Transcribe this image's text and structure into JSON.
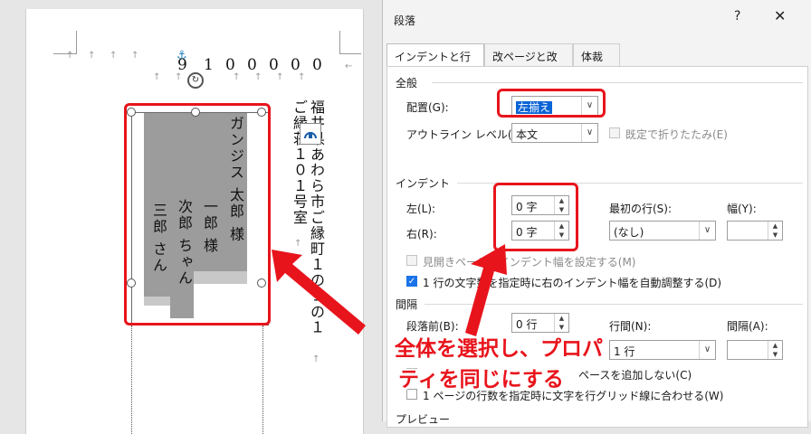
{
  "document": {
    "postal_code": [
      "9",
      "1",
      "0",
      "0",
      "0",
      "0",
      "0"
    ],
    "address_line1": "福井県あわら市ご縁町１の１の１",
    "address_line2": "ご縁荘１０１号室",
    "names": [
      {
        "text": "ガンジス 太郎 様"
      },
      {
        "text": "一郎 様"
      },
      {
        "text": "次郎 ちゃん"
      },
      {
        "text": "三郎 さん"
      }
    ]
  },
  "dialog": {
    "title": "段落",
    "help": "?",
    "close": "✕",
    "tabs": [
      "インデントと行間隔",
      "改ページと改行",
      "体裁"
    ],
    "general": {
      "section": "全般",
      "alignment_label": "配置(G):",
      "alignment_value": "左揃え",
      "outline_label": "アウトライン レベル(O):",
      "outline_value": "本文",
      "collapsed_label": "既定で折りたたみ(E)"
    },
    "indent": {
      "section": "インデント",
      "left_label": "左(L):",
      "left_value": "0 字",
      "right_label": "右(R):",
      "right_value": "0 字",
      "first_line_label": "最初の行(S):",
      "first_line_value": "(なし)",
      "width_label": "幅(Y):",
      "width_value": "",
      "mirror_label": "見開きページのインデント幅を設定する(M)",
      "auto_adjust_label": "1 行の文字数を指定時に右のインデント幅を自動調整する(D)"
    },
    "spacing": {
      "section": "間隔",
      "before_label": "段落前(B):",
      "before_value": "0 行",
      "line_spacing_label": "行間(N):",
      "line_spacing_value": "1 行",
      "at_label": "間隔(A):",
      "at_value": "",
      "no_space_label": "ペースを追加しない(C)",
      "grid_label": "1 ページの行数を指定時に文字を行グリッド線に合わせる(W)"
    },
    "preview_label": "プレビュー"
  },
  "annotation": {
    "line1": "全体を選択し、プロパ",
    "line2": "ティを同じにする",
    "color": "#e8141c"
  }
}
